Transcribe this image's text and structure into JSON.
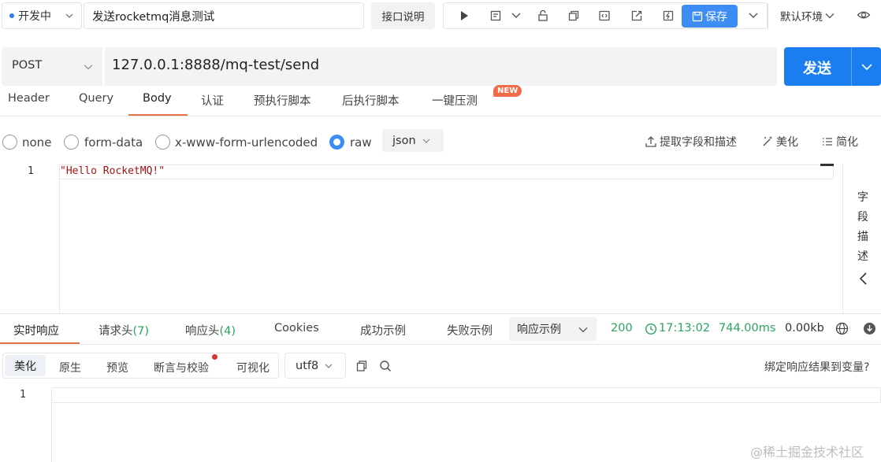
{
  "top": {
    "env_status": "开发中",
    "api_name": "发送rocketmq消息测试",
    "doc_button": "接口说明",
    "save_button": "保存",
    "env_default": "默认环境"
  },
  "request": {
    "method": "POST",
    "url": "127.0.0.1:8888/mq-test/send",
    "send_button": "发送"
  },
  "request_tabs": [
    {
      "label": "Header"
    },
    {
      "label": "Query"
    },
    {
      "label": "Body"
    },
    {
      "label": "认证"
    },
    {
      "label": "预执行脚本"
    },
    {
      "label": "后执行脚本"
    },
    {
      "label": "一键压测"
    }
  ],
  "new_badge": "NEW",
  "body_types": [
    {
      "label": "none"
    },
    {
      "label": "form-data"
    },
    {
      "label": "x-www-form-urlencoded"
    },
    {
      "label": "raw"
    }
  ],
  "raw_format": "json",
  "body_actions": {
    "extract": "提取字段和描述",
    "beautify": "美化",
    "simplify": "简化"
  },
  "editor": {
    "line_number": "1",
    "code": "\"Hello RocketMQ!\""
  },
  "side_panel": [
    "字",
    "段",
    "描",
    "述"
  ],
  "response_tabs": [
    {
      "label": "实时响应",
      "count": ""
    },
    {
      "label": "请求头",
      "count": "(7)"
    },
    {
      "label": "响应头",
      "count": "(4)"
    },
    {
      "label": "Cookies",
      "count": ""
    },
    {
      "label": "成功示例",
      "count": ""
    },
    {
      "label": "失败示例",
      "count": ""
    }
  ],
  "response_example": "响应示例",
  "response_status": {
    "code": "200",
    "time": "17:13:02",
    "duration": "744.00ms",
    "size": "0.00kb"
  },
  "view_tabs": [
    {
      "label": "美化"
    },
    {
      "label": "原生"
    },
    {
      "label": "预览"
    },
    {
      "label": "断言与校验"
    },
    {
      "label": "可视化"
    }
  ],
  "encoding": "utf8",
  "bind_response": "绑定响应结果到变量?",
  "response_editor": {
    "line_number": "1"
  },
  "watermark": "@稀土掘金技术社区"
}
